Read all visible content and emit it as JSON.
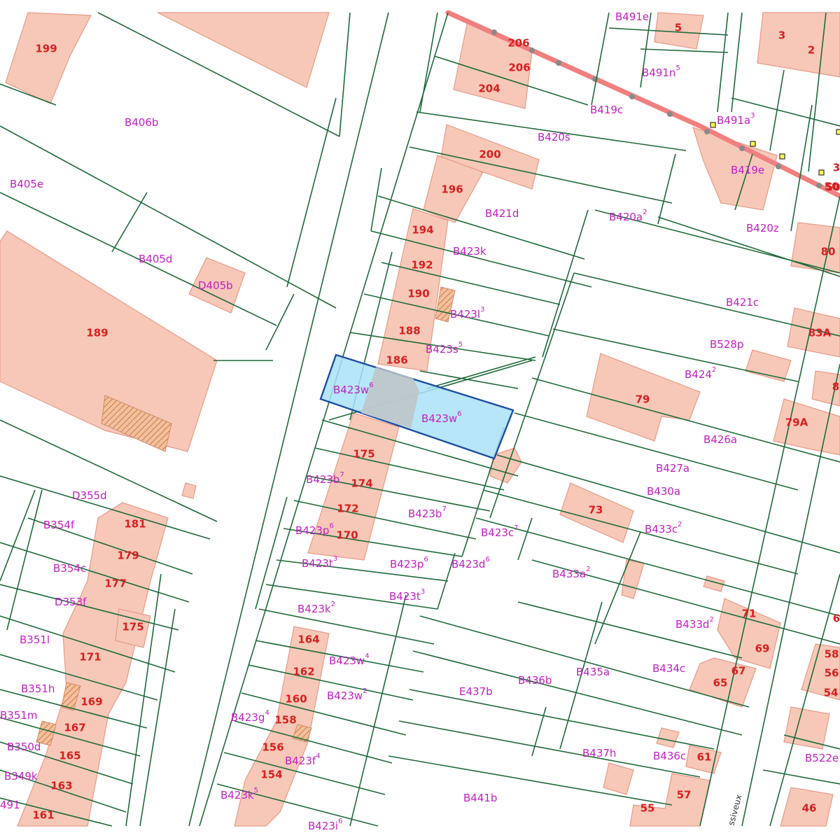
{
  "colors": {
    "parcel_line": "#1f6a3a",
    "building_fill": "#f7c8b8",
    "highlight_fill": "#a9e2f7",
    "highlight_border": "#1c4ea3",
    "house_number": "#d62020",
    "parcel_label": "#c21fc2",
    "road_line": "#f08080"
  },
  "map": {
    "street_label": "ssiveux",
    "house_numbers": [
      "199",
      "189",
      "206",
      "206",
      "204",
      "200",
      "196",
      "194",
      "192",
      "190",
      "188",
      "186",
      "175",
      "174",
      "172",
      "170",
      "5",
      "3",
      "2",
      "80",
      "83A",
      "8",
      "79",
      "79A",
      "73",
      "181",
      "179",
      "177",
      "175",
      "171",
      "169",
      "167",
      "165",
      "163",
      "161",
      "164",
      "162",
      "160",
      "158",
      "156",
      "154",
      "71",
      "69",
      "67",
      "65",
      "58",
      "56",
      "54",
      "50",
      "61",
      "57",
      "55",
      "46",
      "6",
      "3",
      "50"
    ],
    "parcels": [
      {
        "id": "B406b",
        "sup": ""
      },
      {
        "id": "B405e",
        "sup": ""
      },
      {
        "id": "B405d",
        "sup": ""
      },
      {
        "id": "D405b",
        "sup": ""
      },
      {
        "id": "B491e",
        "sup": ""
      },
      {
        "id": "B491n",
        "sup": "5"
      },
      {
        "id": "B419c",
        "sup": ""
      },
      {
        "id": "B491a",
        "sup": "3"
      },
      {
        "id": "B420s",
        "sup": ""
      },
      {
        "id": "B419e",
        "sup": ""
      },
      {
        "id": "B421d",
        "sup": ""
      },
      {
        "id": "B420a",
        "sup": "2"
      },
      {
        "id": "B420z",
        "sup": ""
      },
      {
        "id": "B423k",
        "sup": ""
      },
      {
        "id": "B423l",
        "sup": "3"
      },
      {
        "id": "B421c",
        "sup": ""
      },
      {
        "id": "B423s",
        "sup": "5"
      },
      {
        "id": "B528p",
        "sup": ""
      },
      {
        "id": "B424",
        "sup": "2"
      },
      {
        "id": "B423w",
        "sup": "6"
      },
      {
        "id": "B423w",
        "sup": "6"
      },
      {
        "id": "B426a",
        "sup": ""
      },
      {
        "id": "B427a",
        "sup": ""
      },
      {
        "id": "B423b",
        "sup": "7"
      },
      {
        "id": "B430a",
        "sup": ""
      },
      {
        "id": "D355d",
        "sup": ""
      },
      {
        "id": "B354f",
        "sup": ""
      },
      {
        "id": "B423p",
        "sup": "6"
      },
      {
        "id": "B423b",
        "sup": "7"
      },
      {
        "id": "B423c",
        "sup": "7"
      },
      {
        "id": "B433c",
        "sup": "2"
      },
      {
        "id": "B354c",
        "sup": ""
      },
      {
        "id": "B423t",
        "sup": "3"
      },
      {
        "id": "B423p",
        "sup": "6"
      },
      {
        "id": "B423d",
        "sup": "6"
      },
      {
        "id": "B433a",
        "sup": "2"
      },
      {
        "id": "D353f",
        "sup": ""
      },
      {
        "id": "B423t",
        "sup": "3"
      },
      {
        "id": "B423k",
        "sup": "2"
      },
      {
        "id": "B433d",
        "sup": "2"
      },
      {
        "id": "B351l",
        "sup": ""
      },
      {
        "id": "B423w",
        "sup": "4"
      },
      {
        "id": "B436b",
        "sup": ""
      },
      {
        "id": "B435a",
        "sup": ""
      },
      {
        "id": "B434c",
        "sup": ""
      },
      {
        "id": "B351h",
        "sup": ""
      },
      {
        "id": "B423w",
        "sup": "2"
      },
      {
        "id": "E437b",
        "sup": ""
      },
      {
        "id": "B351m",
        "sup": ""
      },
      {
        "id": "B423g",
        "sup": "4"
      },
      {
        "id": "B350d",
        "sup": ""
      },
      {
        "id": "B423f",
        "sup": "4"
      },
      {
        "id": "B437h",
        "sup": ""
      },
      {
        "id": "B436c",
        "sup": ""
      },
      {
        "id": "B522e",
        "sup": ""
      },
      {
        "id": "B349k",
        "sup": ""
      },
      {
        "id": "B423k",
        "sup": "5"
      },
      {
        "id": "B441b",
        "sup": ""
      },
      {
        "id": "491",
        "sup": ""
      },
      {
        "id": "B423i",
        "sup": "6"
      }
    ]
  }
}
